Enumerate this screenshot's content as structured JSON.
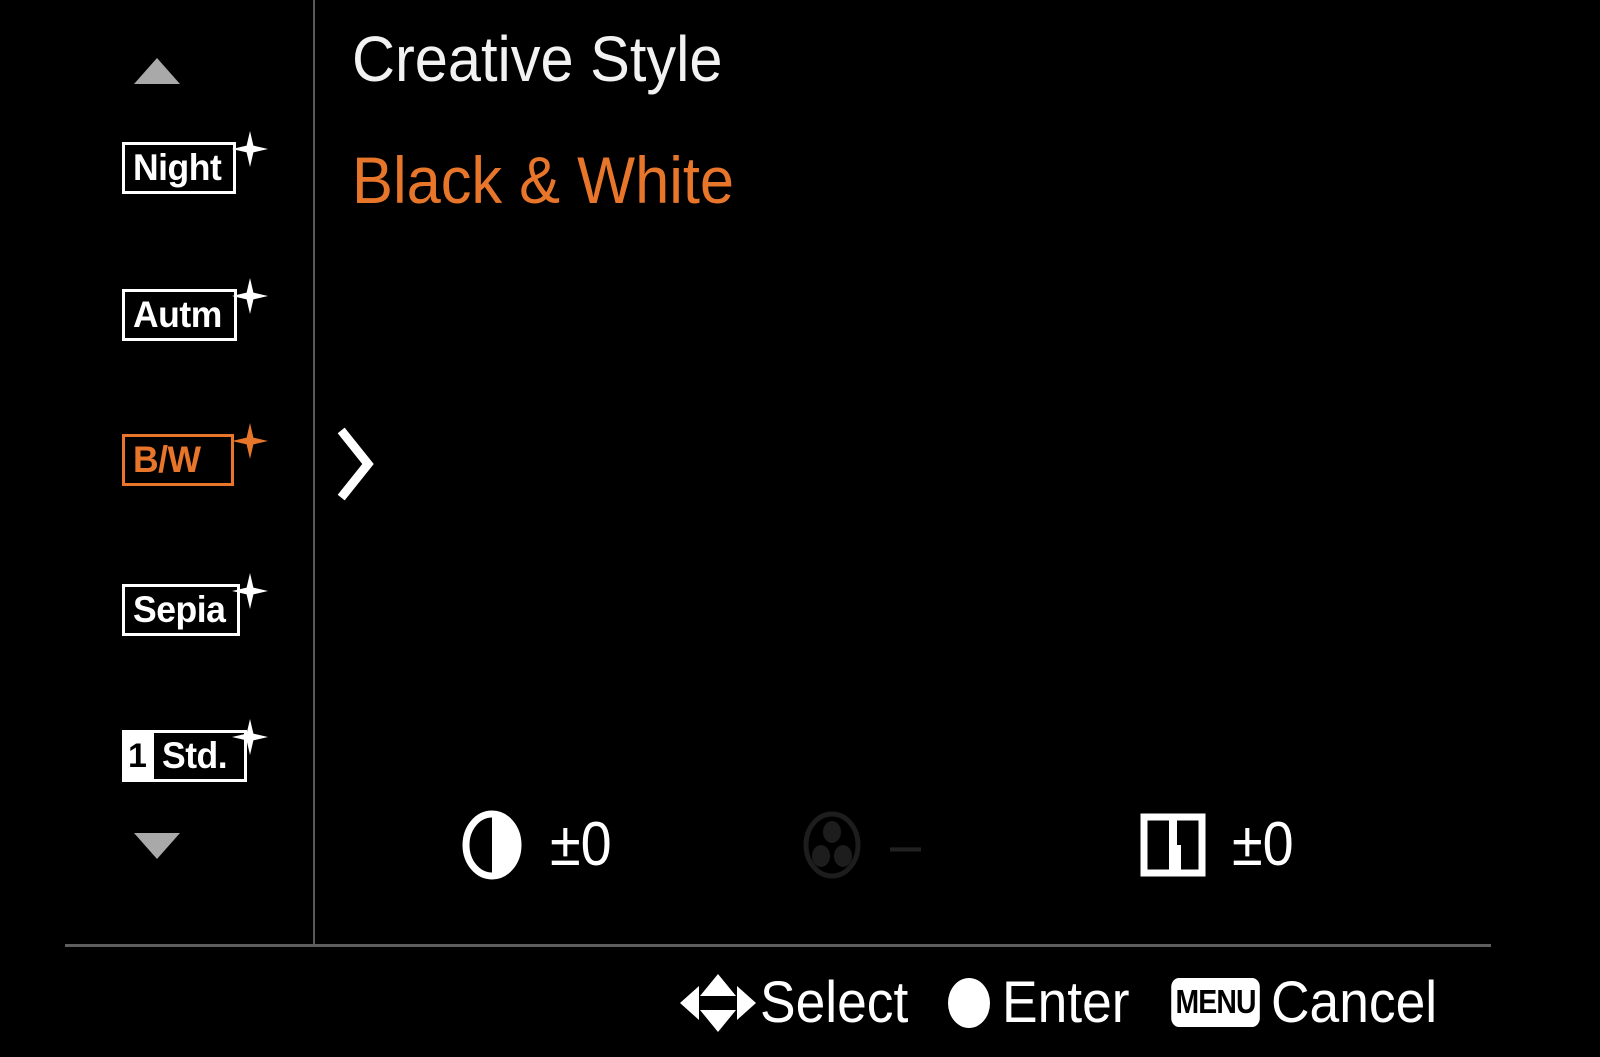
{
  "screen": {
    "title": "Creative Style",
    "selected_value": "Black & White",
    "background_color": "#000000",
    "accent_color": "#e8762a",
    "text_color": "#ffffff",
    "dim_color": "#212121"
  },
  "sidebar": {
    "scroll_up_icon": "triangle-up-icon",
    "scroll_down_icon": "triangle-down-icon",
    "items": [
      {
        "label": "Night",
        "number": "",
        "selected": false,
        "sparkle": "sparkle-icon"
      },
      {
        "label": "Autm",
        "number": "",
        "selected": false,
        "sparkle": "sparkle-icon"
      },
      {
        "label": "B/W",
        "number": "",
        "selected": true,
        "sparkle": "sparkle-icon"
      },
      {
        "label": "Sepia",
        "number": "",
        "selected": false,
        "sparkle": "sparkle-icon"
      },
      {
        "label": "Std.",
        "number": "1",
        "selected": false,
        "sparkle": "sparkle-icon"
      }
    ]
  },
  "main": {
    "expand_icon": "chevron-right-icon",
    "parameters": [
      {
        "icon": "contrast-icon",
        "name": "Contrast",
        "value": "±0",
        "dimmed": false
      },
      {
        "icon": "saturation-icon",
        "name": "Saturation",
        "value": "–",
        "dimmed": true
      },
      {
        "icon": "sharpness-icon",
        "name": "Sharpness",
        "value": "±0",
        "dimmed": false
      }
    ]
  },
  "statusbar": {
    "hints": [
      {
        "icon": "dpad-icon",
        "label": "Select"
      },
      {
        "icon": "center-dot-icon",
        "label": "Enter"
      },
      {
        "icon": "menu-badge-icon",
        "label": "Cancel",
        "badge_text": "MENU"
      }
    ]
  }
}
